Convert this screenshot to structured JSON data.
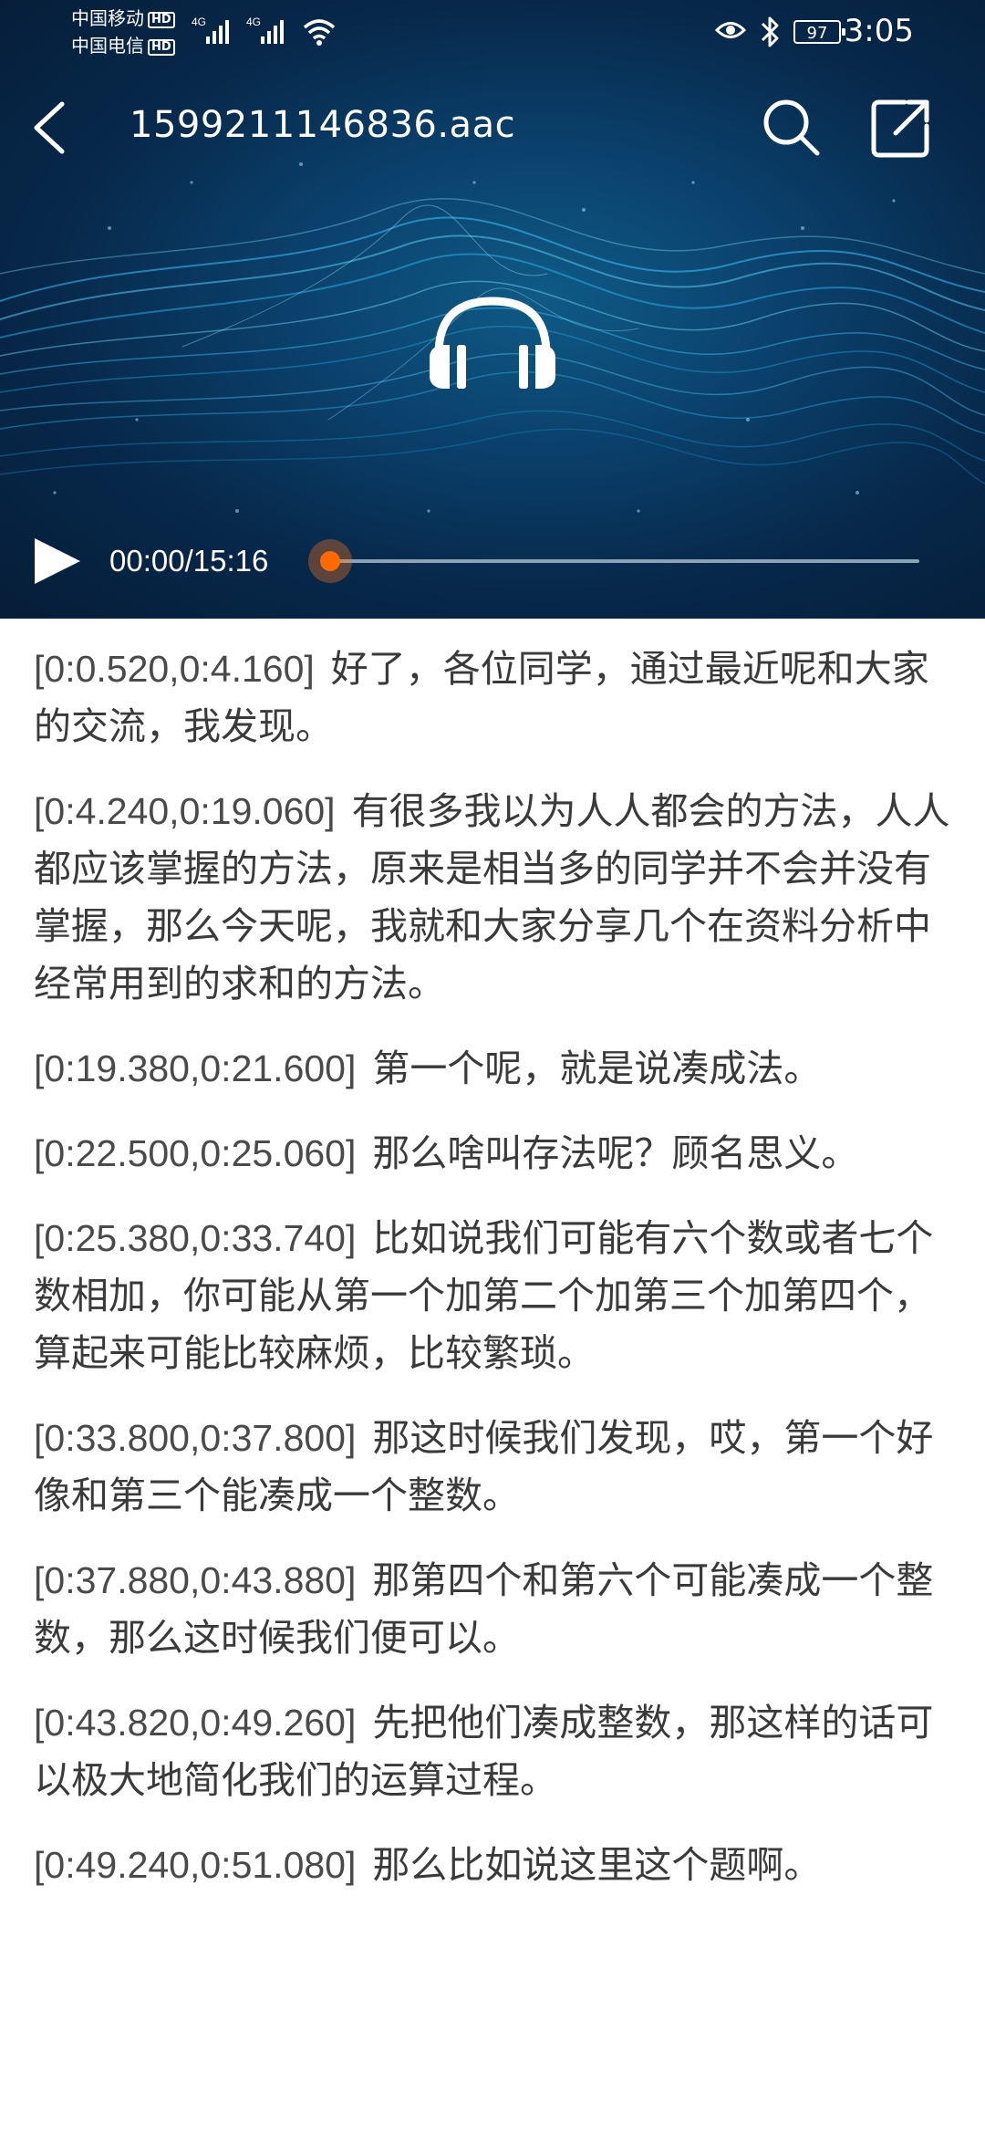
{
  "status_bar": {
    "carrier1": "中国移动",
    "carrier2": "中国电信",
    "hd_badge": "HD",
    "network_label": "4G",
    "battery": "97",
    "time": "3:05"
  },
  "app_bar": {
    "title": "1599211146836.aac",
    "icons": [
      "back-icon",
      "search-icon",
      "share-icon"
    ]
  },
  "player": {
    "time_display": "00:00/15:16",
    "progress": 0,
    "accent_color": "#ff6a00"
  },
  "transcript": [
    {
      "time": "[0:0.520,0:4.160]",
      "text": "好了，各位同学，通过最近呢和大家的交流，我发现。"
    },
    {
      "time": "[0:4.240,0:19.060]",
      "text": "有很多我以为人人都会的方法，人人都应该掌握的方法，原来是相当多的同学并不会并没有掌握，那么今天呢，我就和大家分享几个在资料分析中经常用到的求和的方法。"
    },
    {
      "time": "[0:19.380,0:21.600]",
      "text": "第一个呢，就是说凑成法。"
    },
    {
      "time": "[0:22.500,0:25.060]",
      "text": "那么啥叫存法呢？顾名思义。"
    },
    {
      "time": "[0:25.380,0:33.740]",
      "text": "比如说我们可能有六个数或者七个数相加，你可能从第一个加第二个加第三个加第四个，算起来可能比较麻烦，比较繁琐。"
    },
    {
      "time": "[0:33.800,0:37.800]",
      "text": "那这时候我们发现，哎，第一个好像和第三个能凑成一个整数。"
    },
    {
      "time": "[0:37.880,0:43.880]",
      "text": "那第四个和第六个可能凑成一个整数，那么这时候我们便可以。"
    },
    {
      "time": "[0:43.820,0:49.260]",
      "text": "先把他们凑成整数，那这样的话可以极大地简化我们的运算过程。"
    },
    {
      "time": "[0:49.240,0:51.080]",
      "text": "那么比如说这里这个题啊。"
    }
  ]
}
